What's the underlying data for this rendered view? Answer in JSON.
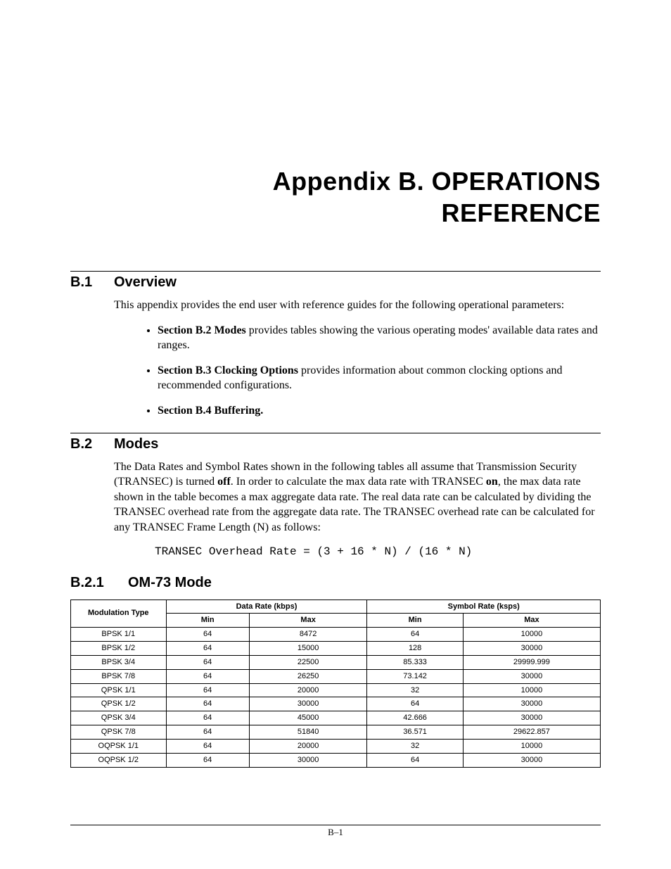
{
  "title_line1": "Appendix B.  OPERATIONS",
  "title_line2": "REFERENCE",
  "s1": {
    "num": "B.1",
    "label": "Overview",
    "intro": "This appendix provides the end user with reference guides for the following operational parameters:",
    "bullets": [
      {
        "b": "Section B.2 Modes",
        "rest": " provides tables showing the various operating modes' available data rates and ranges."
      },
      {
        "b": "Section B.3 Clocking Options",
        "rest": " provides information about common clocking options and recommended configurations."
      },
      {
        "b": "Section B.4 Buffering.",
        "rest": ""
      }
    ]
  },
  "s2": {
    "num": "B.2",
    "label": "Modes",
    "p_part1": "The Data Rates and Symbol Rates shown in the following tables all assume that Transmission Security (TRANSEC) is turned ",
    "p_off": "off",
    "p_part2": ". In order to calculate the max data rate with TRANSEC ",
    "p_on": "on",
    "p_part3": ", the max data rate shown in the table becomes a max aggregate data rate. The real data rate can be calculated by dividing the TRANSEC overhead rate from the aggregate data rate. The TRANSEC overhead rate can be calculated for any TRANSEC Frame Length (N) as follows:",
    "formula": "TRANSEC Overhead Rate = (3 + 16 * N) / (16 * N)"
  },
  "s21": {
    "num": "B.2.1",
    "label": "OM-73 Mode"
  },
  "table": {
    "h_mod": "Modulation Type",
    "h_data": "Data Rate (kbps)",
    "h_sym": "Symbol Rate (ksps)",
    "h_min": "Min",
    "h_max": "Max",
    "rows": [
      {
        "m": "BPSK 1/1",
        "dmin": "64",
        "dmax": "8472",
        "smin": "64",
        "smax": "10000"
      },
      {
        "m": "BPSK 1/2",
        "dmin": "64",
        "dmax": "15000",
        "smin": "128",
        "smax": "30000"
      },
      {
        "m": "BPSK 3/4",
        "dmin": "64",
        "dmax": "22500",
        "smin": "85.333",
        "smax": "29999.999"
      },
      {
        "m": "BPSK 7/8",
        "dmin": "64",
        "dmax": "26250",
        "smin": "73.142",
        "smax": "30000"
      },
      {
        "m": "QPSK 1/1",
        "dmin": "64",
        "dmax": "20000",
        "smin": "32",
        "smax": "10000"
      },
      {
        "m": "QPSK 1/2",
        "dmin": "64",
        "dmax": "30000",
        "smin": "64",
        "smax": "30000"
      },
      {
        "m": "QPSK 3/4",
        "dmin": "64",
        "dmax": "45000",
        "smin": "42.666",
        "smax": "30000"
      },
      {
        "m": "QPSK 7/8",
        "dmin": "64",
        "dmax": "51840",
        "smin": "36.571",
        "smax": "29622.857"
      },
      {
        "m": "OQPSK 1/1",
        "dmin": "64",
        "dmax": "20000",
        "smin": "32",
        "smax": "10000"
      },
      {
        "m": "OQPSK 1/2",
        "dmin": "64",
        "dmax": "30000",
        "smin": "64",
        "smax": "30000"
      }
    ]
  },
  "page_num": "B–1"
}
